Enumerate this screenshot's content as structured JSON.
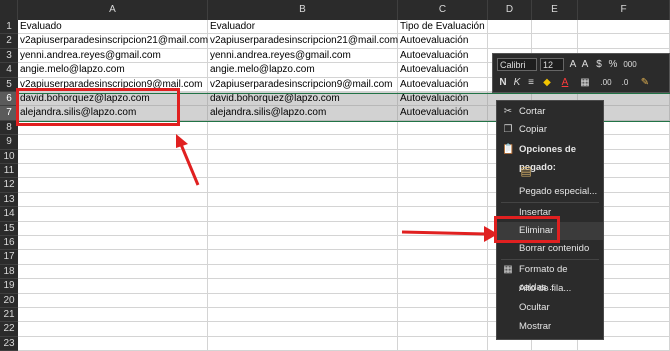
{
  "columns": [
    "A",
    "B",
    "C",
    "D",
    "E",
    "F"
  ],
  "rows": [
    {
      "num": "1",
      "a": "Evaluado",
      "b": "Evaluador",
      "c": "Tipo de Evaluación"
    },
    {
      "num": "2",
      "a": "v2apiuserparadesinscripcion21@mail.com",
      "b": "v2apiuserparadesinscripcion21@mail.com",
      "c": "Autoevaluación"
    },
    {
      "num": "3",
      "a": "yenni.andrea.reyes@gmail.com",
      "b": "yenni.andrea.reyes@gmail.com",
      "c": "Autoevaluación"
    },
    {
      "num": "4",
      "a": "angie.melo@lapzo.com",
      "b": "angie.melo@lapzo.com",
      "c": "Autoevaluación"
    },
    {
      "num": "5",
      "a": "v2apiuserparadesinscripcion9@mail.com",
      "b": "v2apiuserparadesinscripcion9@mail.com",
      "c": "Autoevaluación"
    },
    {
      "num": "6",
      "a": "david.bohorquez@lapzo.com",
      "b": "david.bohorquez@lapzo.com",
      "c": "Autoevaluación"
    },
    {
      "num": "7",
      "a": "alejandra.silis@lapzo.com",
      "b": "alejandra.silis@lapzo.com",
      "c": "Autoevaluación"
    },
    {
      "num": "8",
      "a": "",
      "b": "",
      "c": ""
    },
    {
      "num": "9",
      "a": "",
      "b": "",
      "c": ""
    },
    {
      "num": "10",
      "a": "",
      "b": "",
      "c": ""
    },
    {
      "num": "11",
      "a": "",
      "b": "",
      "c": ""
    },
    {
      "num": "12",
      "a": "",
      "b": "",
      "c": ""
    },
    {
      "num": "13",
      "a": "",
      "b": "",
      "c": ""
    },
    {
      "num": "14",
      "a": "",
      "b": "",
      "c": ""
    },
    {
      "num": "15",
      "a": "",
      "b": "",
      "c": ""
    },
    {
      "num": "16",
      "a": "",
      "b": "",
      "c": ""
    },
    {
      "num": "17",
      "a": "",
      "b": "",
      "c": ""
    },
    {
      "num": "18",
      "a": "",
      "b": "",
      "c": ""
    },
    {
      "num": "19",
      "a": "",
      "b": "",
      "c": ""
    },
    {
      "num": "20",
      "a": "",
      "b": "",
      "c": ""
    },
    {
      "num": "21",
      "a": "",
      "b": "",
      "c": ""
    },
    {
      "num": "22",
      "a": "",
      "b": "",
      "c": ""
    },
    {
      "num": "23",
      "a": "",
      "b": "",
      "c": ""
    }
  ],
  "selected_rows": [
    "6",
    "7"
  ],
  "mini_toolbar": {
    "font": "Calibri",
    "size": "12",
    "buttons": [
      "A",
      "A",
      "$",
      "%",
      "000",
      "N",
      "K",
      "≡",
      "A",
      ".00",
      ".0"
    ]
  },
  "context_menu": {
    "cut": "Cortar",
    "copy": "Copiar",
    "paste_options": "Opciones de pegado:",
    "paste_special": "Pegado especial...",
    "insert": "Insertar",
    "delete": "Eliminar",
    "clear": "Borrar contenido",
    "format_cells": "Formato de celdas...",
    "row_height": "Alto de fila...",
    "hide": "Ocultar",
    "unhide": "Mostrar"
  },
  "colors": {
    "highlight_red": "#e02020",
    "selection_green": "#217346",
    "menu_bg": "#2b2b2b"
  }
}
